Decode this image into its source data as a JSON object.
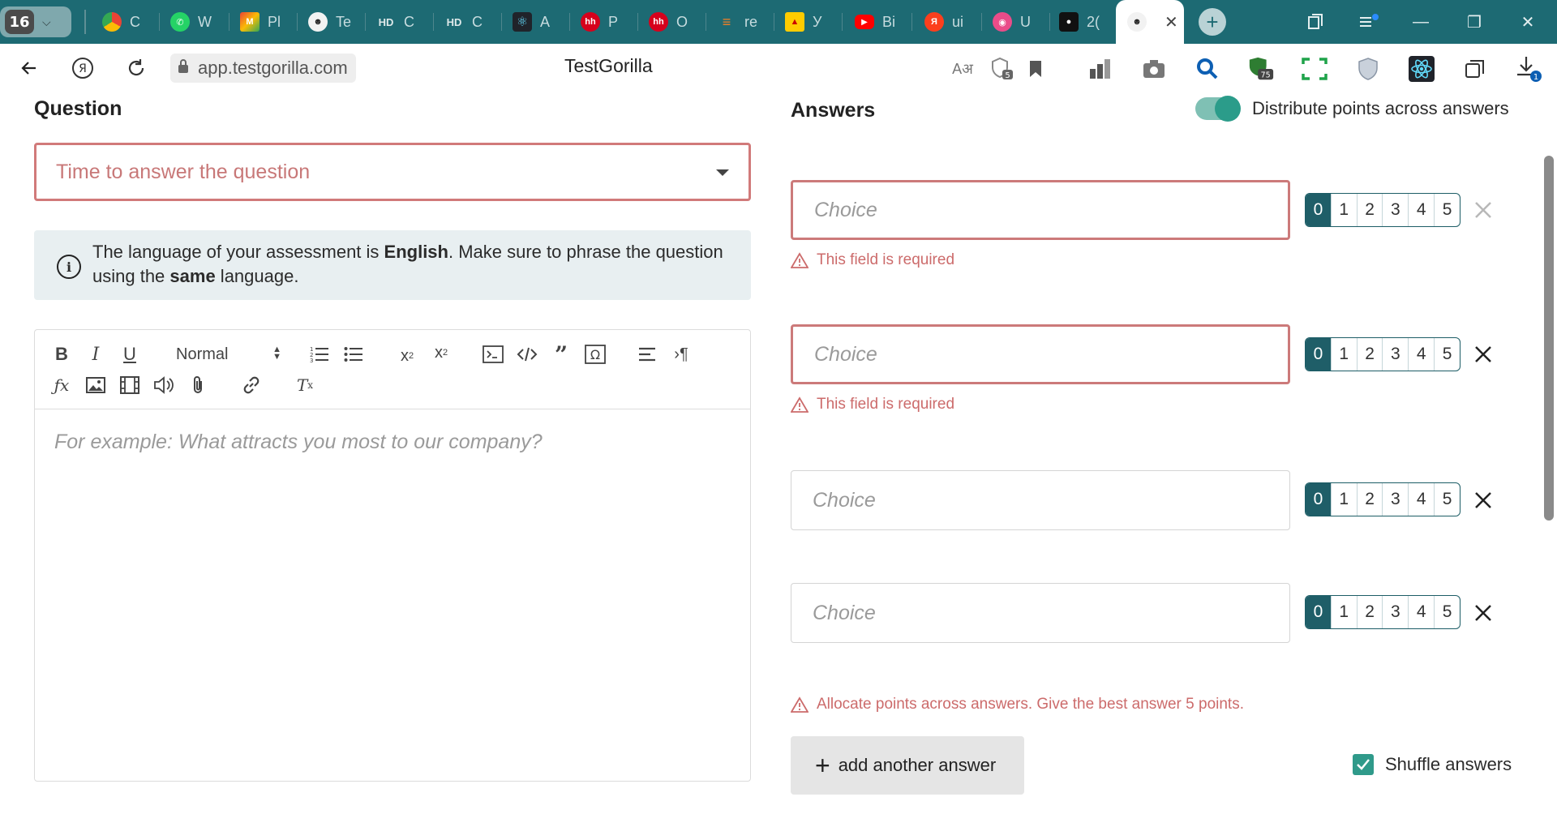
{
  "browser": {
    "tab_count": "16",
    "tabs": [
      {
        "icon": "chrome-logo-icon",
        "label": "C",
        "color": "#e94235"
      },
      {
        "icon": "whatsapp-icon",
        "label": "W",
        "color": "#25d366"
      },
      {
        "icon": "gmail-icon",
        "label": "Pl",
        "color": "#ea4335"
      },
      {
        "icon": "testgorilla-icon",
        "label": "Te",
        "color": "#333333"
      },
      {
        "icon": "hd-icon",
        "label": "C",
        "color": "#333333"
      },
      {
        "icon": "hd-icon",
        "label": "C",
        "color": "#333333"
      },
      {
        "icon": "react-icon",
        "label": "A",
        "color": "#61dafb"
      },
      {
        "icon": "hh-icon",
        "label": "P",
        "color": "#d6001c"
      },
      {
        "icon": "hh-icon",
        "label": "O",
        "color": "#d6001c"
      },
      {
        "icon": "stackoverflow-icon",
        "label": "re",
        "color": "#f48024"
      },
      {
        "icon": "yandex-market-icon",
        "label": "У",
        "color": "#ffcc00"
      },
      {
        "icon": "youtube-icon",
        "label": "Bi",
        "color": "#ff0000"
      },
      {
        "icon": "yandex-icon",
        "label": "ui",
        "color": "#fc3f1d"
      },
      {
        "icon": "dribbble-icon",
        "label": "U",
        "color": "#ea4c89"
      },
      {
        "icon": "tab-app-icon",
        "label": "2(",
        "color": "#111111"
      }
    ],
    "active_tab_icon": "testgorilla-icon",
    "url": "app.testgorilla.com",
    "page_title": "TestGorilla",
    "download_badge": "1",
    "extension_badge": "75",
    "shield_badge": "5"
  },
  "question": {
    "heading": "Question",
    "time_select_placeholder": "Time to answer the question",
    "info_prefix": "The language of your assessment is ",
    "info_language": "English",
    "info_middle": ". Make sure to phrase the question using the ",
    "info_same": "same",
    "info_suffix": " language.",
    "editor": {
      "format_select": "Normal",
      "placeholder": "For example: What attracts you most to our company?"
    }
  },
  "answers": {
    "heading": "Answers",
    "distribute_label": "Distribute points across answers",
    "distribute_on": true,
    "choices": [
      {
        "placeholder": "Choice",
        "error": "This field is required",
        "selected_points": 0
      },
      {
        "placeholder": "Choice",
        "error": "This field is required",
        "selected_points": 0
      },
      {
        "placeholder": "Choice",
        "error": "",
        "selected_points": 0
      },
      {
        "placeholder": "Choice",
        "error": "",
        "selected_points": 0
      }
    ],
    "points_options": [
      "0",
      "1",
      "2",
      "3",
      "4",
      "5"
    ],
    "allocate_warning": "Allocate points across answers. Give the best answer 5 points.",
    "add_button_label": "add another answer",
    "shuffle_label": "Shuffle answers",
    "shuffle_checked": true
  },
  "colors": {
    "tabstrip": "#1d6a73",
    "error": "#cc6b6b",
    "accent": "#2b9c8a",
    "points_selected": "#1f5e68"
  }
}
